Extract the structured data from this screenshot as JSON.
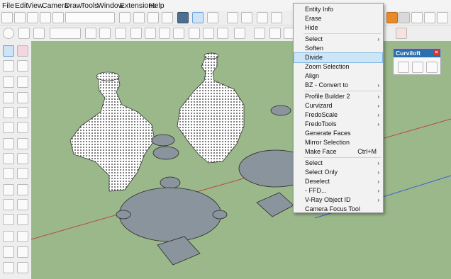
{
  "menubar": {
    "items": [
      "File",
      "Edit",
      "View",
      "Camera",
      "Draw",
      "Tools",
      "Window",
      "Extensions",
      "Help"
    ]
  },
  "context_menu": {
    "items": [
      {
        "label": "Entity Info",
        "shortcut": "",
        "submenu": false,
        "highlighted": false
      },
      {
        "label": "Erase",
        "shortcut": "",
        "submenu": false,
        "highlighted": false
      },
      {
        "label": "Hide",
        "shortcut": "",
        "submenu": false,
        "highlighted": false
      },
      {
        "label": "Select",
        "shortcut": "",
        "submenu": true,
        "highlighted": false
      },
      {
        "label": "Soften",
        "shortcut": "",
        "submenu": false,
        "highlighted": false
      },
      {
        "label": "Divide",
        "shortcut": "",
        "submenu": false,
        "highlighted": true
      },
      {
        "label": "Zoom Selection",
        "shortcut": "",
        "submenu": false,
        "highlighted": false
      },
      {
        "label": "Align",
        "shortcut": "",
        "submenu": false,
        "highlighted": false
      },
      {
        "label": "BZ - Convert to",
        "shortcut": "",
        "submenu": true,
        "highlighted": false
      },
      {
        "label": "Profile Builder 2",
        "shortcut": "",
        "submenu": true,
        "highlighted": false
      },
      {
        "label": "Curvizard",
        "shortcut": "",
        "submenu": true,
        "highlighted": false
      },
      {
        "label": "FredoScale",
        "shortcut": "",
        "submenu": true,
        "highlighted": false
      },
      {
        "label": "FredoTools",
        "shortcut": "",
        "submenu": true,
        "highlighted": false
      },
      {
        "label": "Generate Faces",
        "shortcut": "",
        "submenu": false,
        "highlighted": false
      },
      {
        "label": "Mirror Selection",
        "shortcut": "",
        "submenu": false,
        "highlighted": false
      },
      {
        "label": "Make Face",
        "shortcut": "Ctrl+M",
        "submenu": false,
        "highlighted": false
      },
      {
        "label": "Select",
        "shortcut": "",
        "submenu": true,
        "highlighted": false
      },
      {
        "label": "Select Only",
        "shortcut": "",
        "submenu": true,
        "highlighted": false
      },
      {
        "label": "Deselect",
        "shortcut": "",
        "submenu": true,
        "highlighted": false
      },
      {
        "label": "- FFD...",
        "shortcut": "",
        "submenu": true,
        "highlighted": false
      },
      {
        "label": "V-Ray Object ID",
        "shortcut": "",
        "submenu": true,
        "highlighted": false
      },
      {
        "label": "Camera Focus Tool",
        "shortcut": "",
        "submenu": false,
        "highlighted": false
      }
    ]
  },
  "curviloft_panel": {
    "title": "Curviloft",
    "close_icon": "close-icon",
    "tools": [
      "loft-by-spline-icon",
      "loft-along-path-icon",
      "skin-contours-icon"
    ]
  },
  "left_toolbar": {
    "tools": [
      "select-arrow-icon",
      "eraser-icon",
      "paint-bucket-icon",
      "make-component-icon",
      "line-icon",
      "freehand-icon",
      "rectangle-icon",
      "rotated-rectangle-icon",
      "circle-icon",
      "polygon-icon",
      "arc-icon",
      "pie-icon",
      "move-icon",
      "push-pull-icon",
      "rotate-icon",
      "follow-me-icon",
      "scale-icon",
      "offset-icon",
      "tape-measure-icon",
      "dimension-icon",
      "protractor-icon",
      "text-icon",
      "axes-icon",
      "section-plane-icon",
      "orbit-icon",
      "pan-icon",
      "zoom-icon",
      "zoom-extents-icon"
    ]
  },
  "colors": {
    "viewport_bg": "#9bb88b",
    "menu_highlight": "#cde6f7",
    "curviloft_header": "#2a6fb0"
  }
}
